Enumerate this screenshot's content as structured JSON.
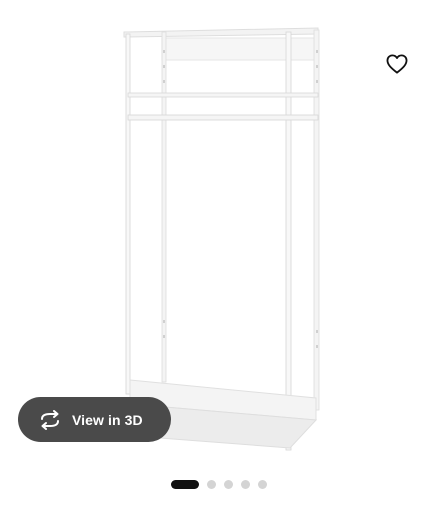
{
  "product_gallery": {
    "image": "open-wardrobe-frame-with-clothes-rail",
    "favorite_icon": "heart-outline-icon",
    "view_3d": {
      "label": "View in 3D",
      "icon": "rotate-3d-icon"
    },
    "pagination": {
      "total": 5,
      "current": 1
    }
  },
  "colors": {
    "button_bg": "#4a4a4a",
    "dot_active": "#111111",
    "dot_inactive": "#d4d4d4"
  }
}
